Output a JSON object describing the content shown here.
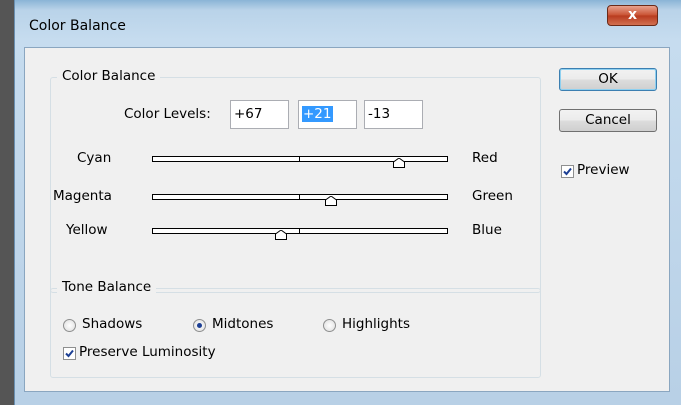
{
  "window": {
    "title": "Color Balance",
    "close_label": "x"
  },
  "color_balance": {
    "group_label": "Color Balance",
    "levels_label": "Color Levels:",
    "levels": [
      "+67",
      "+21",
      "-13"
    ],
    "sliders": [
      {
        "left": "Cyan",
        "right": "Red",
        "value": 67
      },
      {
        "left": "Magenta",
        "right": "Green",
        "value": 21
      },
      {
        "left": "Yellow",
        "right": "Blue",
        "value": -13
      }
    ]
  },
  "buttons": {
    "ok": "OK",
    "cancel": "Cancel"
  },
  "preview": {
    "label": "Preview",
    "checked": true
  },
  "tone_balance": {
    "group_label": "Tone Balance",
    "options": [
      "Shadows",
      "Midtones",
      "Highlights"
    ],
    "selected": "Midtones",
    "preserve_label": "Preserve Luminosity",
    "preserve_checked": true
  }
}
